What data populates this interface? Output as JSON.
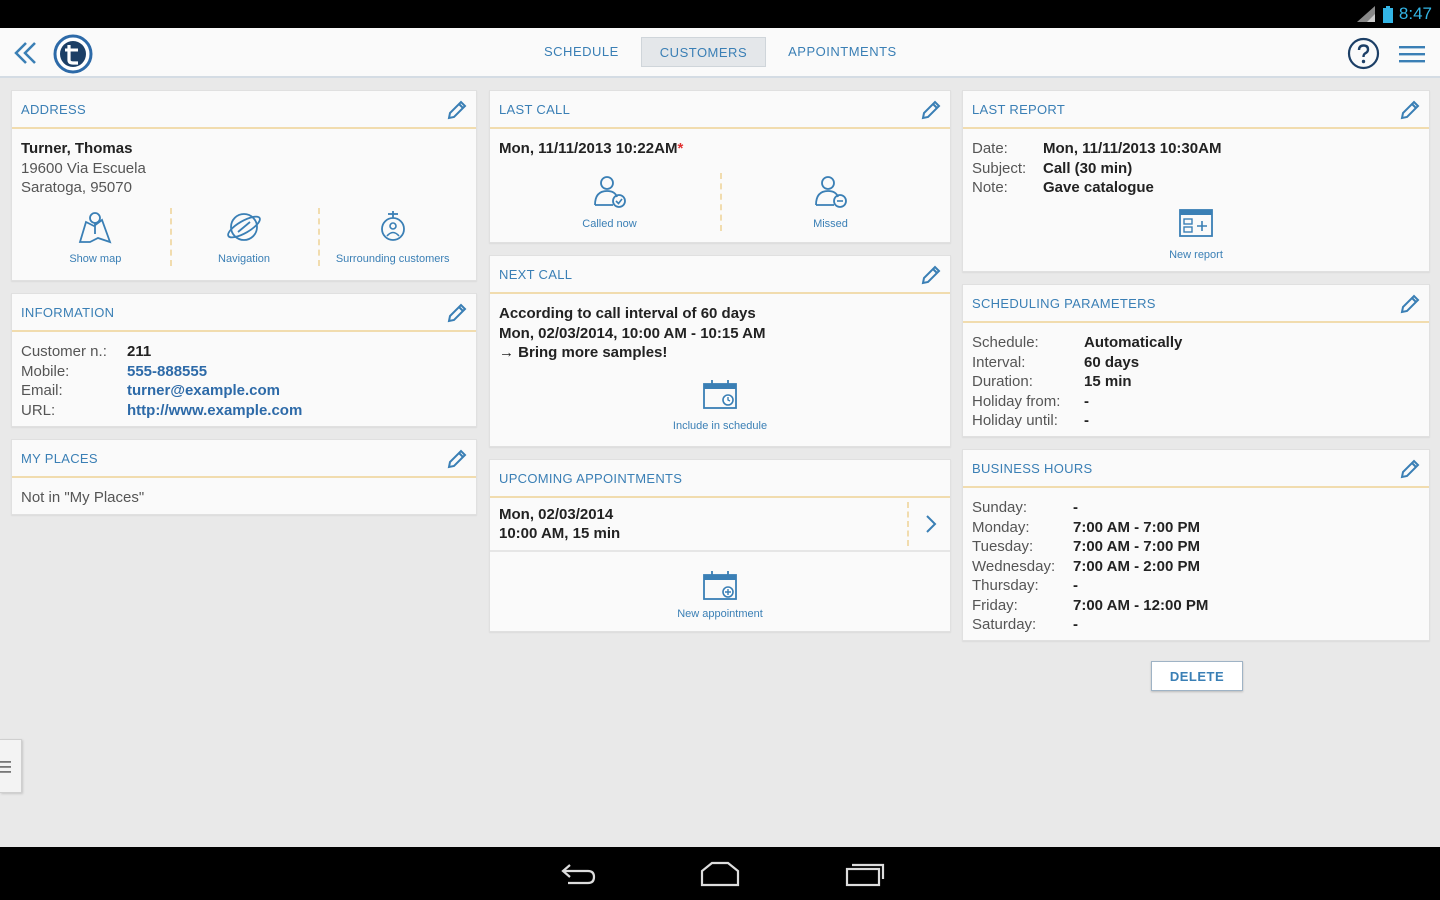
{
  "status": {
    "time": "8:47"
  },
  "nav": {
    "tabs": [
      {
        "label": "SCHEDULE"
      },
      {
        "label": "CUSTOMERS"
      },
      {
        "label": "APPOINTMENTS"
      }
    ]
  },
  "address": {
    "title": "ADDRESS",
    "name": "Turner, Thomas",
    "street": "19600 Via Escuela",
    "city": "Saratoga, 95070",
    "actions": [
      "Show map",
      "Navigation",
      "Surrounding customers"
    ]
  },
  "information": {
    "title": "INFORMATION",
    "rows": [
      {
        "key": "Customer n.:",
        "value": "211"
      },
      {
        "key": "Mobile:",
        "value": "555-888555"
      },
      {
        "key": "Email:",
        "value": "turner@example.com"
      },
      {
        "key": "URL:",
        "value": "http://www.example.com"
      }
    ]
  },
  "my_places": {
    "title": "MY PLACES",
    "text": "Not in \"My Places\""
  },
  "last_call": {
    "title": "LAST CALL",
    "datetime": "Mon, 11/11/2013 10:22AM",
    "marker": "*",
    "actions": [
      "Called now",
      "Missed"
    ]
  },
  "next_call": {
    "title": "NEXT CALL",
    "line1": "According to call interval of 60 days",
    "line2": "Mon, 02/03/2014, 10:00 AM - 10:15 AM",
    "line3": "→ Bring more samples!",
    "action": "Include in schedule"
  },
  "upcoming": {
    "title": "UPCOMING APPOINTMENTS",
    "line1": "Mon, 02/03/2014",
    "line2": "10:00 AM, 15 min",
    "action": "New appointment"
  },
  "last_report": {
    "title": "LAST REPORT",
    "rows": [
      {
        "key": "Date:",
        "value": "Mon, 11/11/2013 10:30AM"
      },
      {
        "key": "Subject:",
        "value": "Call (30 min)"
      },
      {
        "key": "Note:",
        "value": "Gave catalogue"
      }
    ],
    "action": "New report"
  },
  "scheduling": {
    "title": "SCHEDULING PARAMETERS",
    "rows": [
      {
        "key": "Schedule:",
        "value": "Automatically"
      },
      {
        "key": "Interval:",
        "value": "60 days"
      },
      {
        "key": "Duration:",
        "value": "15 min"
      },
      {
        "key": "Holiday from:",
        "value": "-"
      },
      {
        "key": "Holiday until:",
        "value": "-"
      }
    ]
  },
  "business_hours": {
    "title": "BUSINESS HOURS",
    "rows": [
      {
        "key": "Sunday:",
        "value": "-"
      },
      {
        "key": "Monday:",
        "value": "7:00 AM - 7:00 PM"
      },
      {
        "key": "Tuesday:",
        "value": "7:00 AM - 7:00 PM"
      },
      {
        "key": "Wednesday:",
        "value": "7:00 AM - 2:00 PM"
      },
      {
        "key": "Thursday:",
        "value": "-"
      },
      {
        "key": "Friday:",
        "value": "7:00 AM - 12:00 PM"
      },
      {
        "key": "Saturday:",
        "value": "-"
      }
    ]
  },
  "delete_label": "DELETE",
  "colors": {
    "accent": "#3a7fb5",
    "divider": "#f1dcae",
    "status_blue": "#33b5e5"
  }
}
